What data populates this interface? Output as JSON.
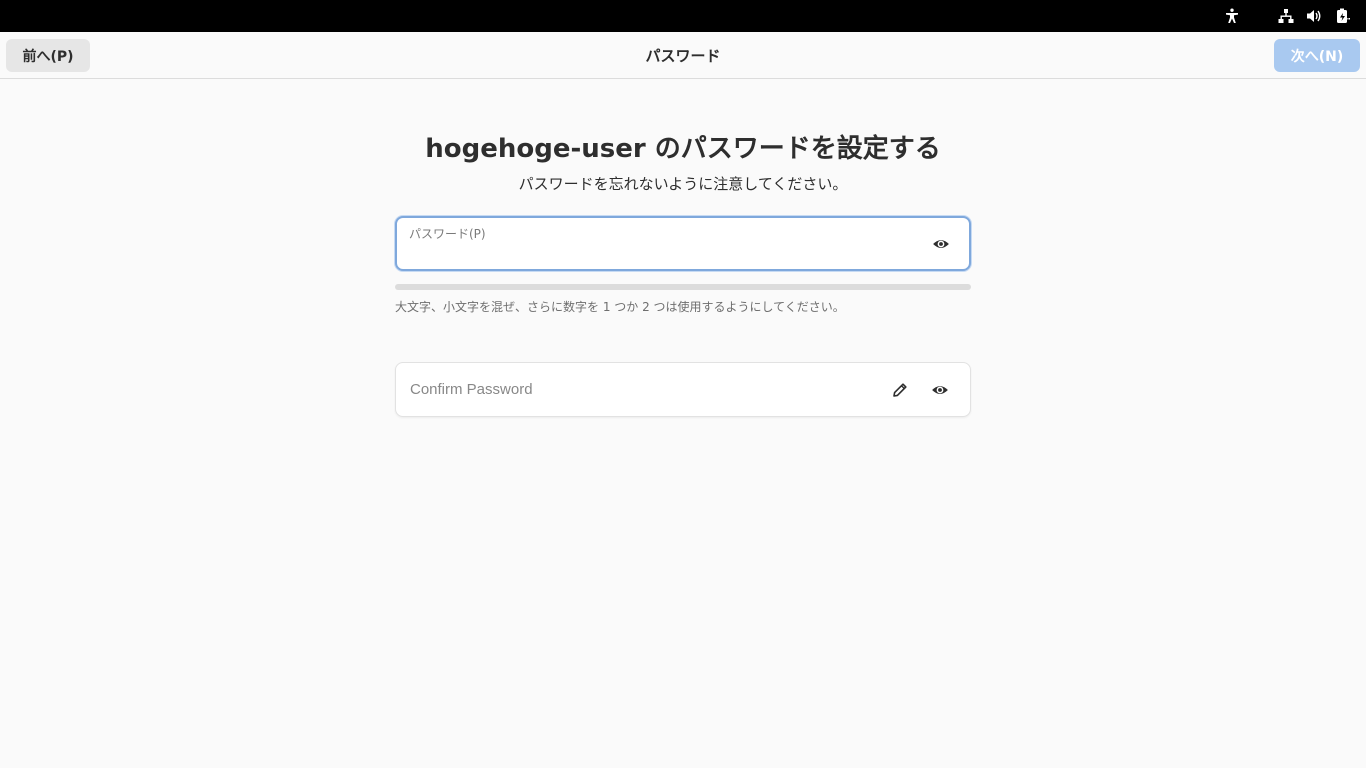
{
  "topbar": {
    "icons": [
      "accessibility-icon",
      "network-wired-icon",
      "volume-icon",
      "battery-icon"
    ]
  },
  "header": {
    "back_label": "前へ(P)",
    "title": "パスワード",
    "next_label": "次へ(N)"
  },
  "main": {
    "title": "hogehoge-user のパスワードを設定する",
    "subtitle": "パスワードを忘れないように注意してください。"
  },
  "password_field": {
    "label": "パスワード(P)",
    "value": "",
    "reveal_icon": "eye-icon"
  },
  "strength": {
    "level": 0,
    "hint": "大文字、小文字を混ぜ、さらに数字を 1 つか 2 つは使用するようにしてください。"
  },
  "confirm_field": {
    "placeholder": "Confirm Password",
    "value": "",
    "edit_icon": "pencil-icon",
    "reveal_icon": "eye-icon"
  },
  "colors": {
    "accent": "#3584e4",
    "next_button_disabled": "#a9c9f0",
    "focus_border": "#7fa8dc",
    "background": "#fafafa",
    "topbar": "#000000"
  }
}
